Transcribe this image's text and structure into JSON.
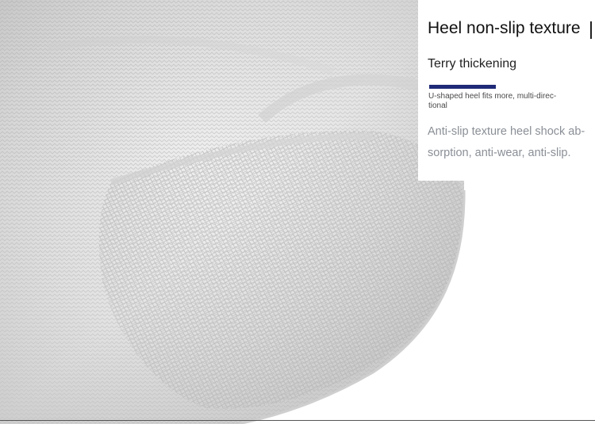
{
  "heading": {
    "title": "Heel non-slip texture",
    "subtitle": "Terry thickening"
  },
  "note": "U-shaped heel fits more, multi-direc- tional",
  "description": "Anti-slip texture heel shock ab- sorption, anti-wear, anti-slip.",
  "colors": {
    "accent_bar": "#1f2a78",
    "sock": "#e6e6e6",
    "background": "#ffffff"
  }
}
